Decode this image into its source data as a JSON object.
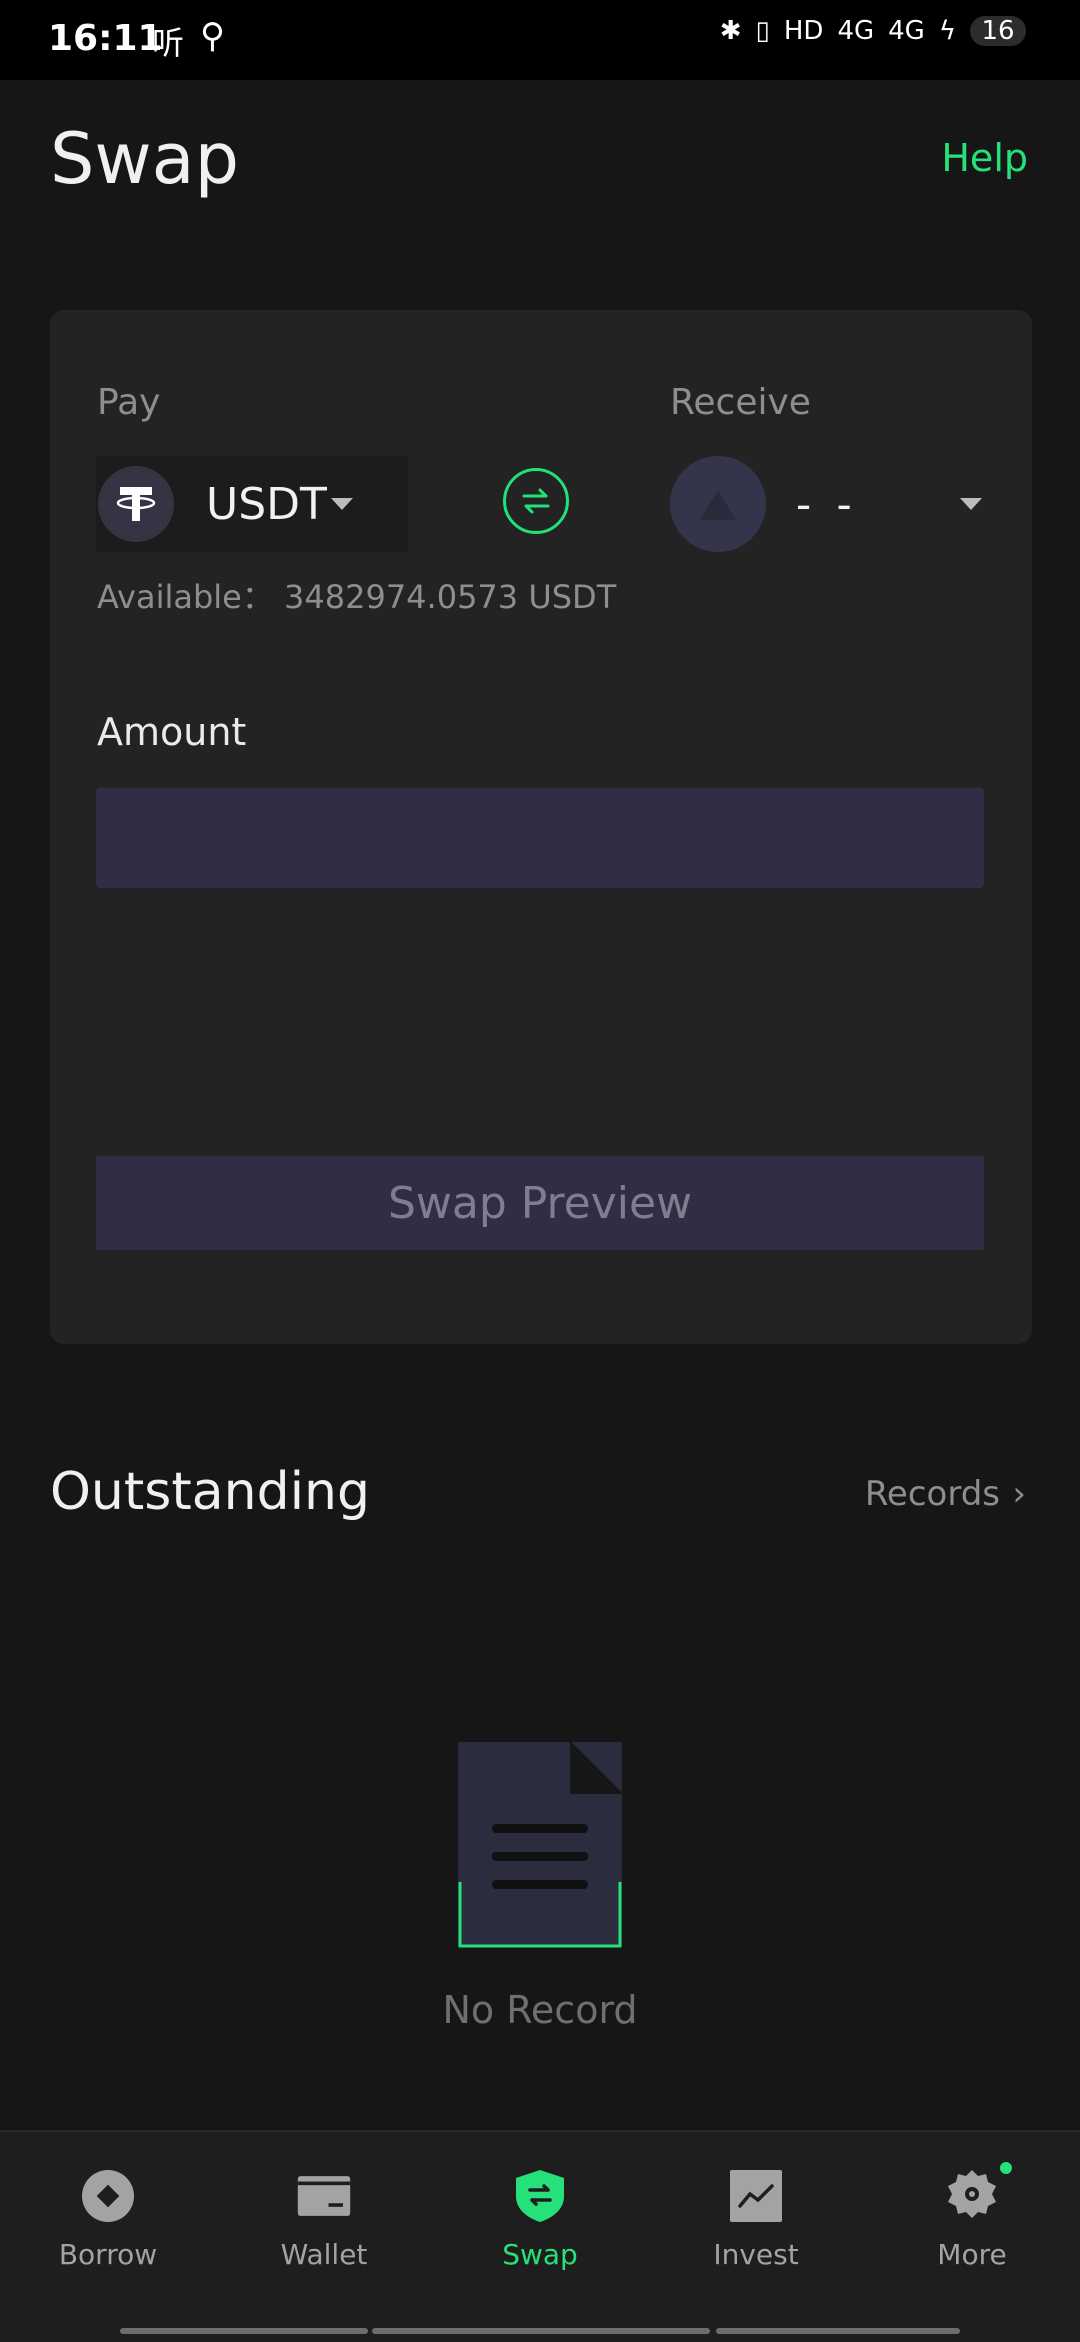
{
  "status_bar": {
    "time": "16:11",
    "cn_label": "听",
    "battery": "16",
    "signal_labels": [
      "HD",
      "4G",
      "4G"
    ]
  },
  "header": {
    "title": "Swap",
    "help": "Help"
  },
  "swap": {
    "pay_label": "Pay",
    "receive_label": "Receive",
    "pay_token": "USDT",
    "receive_token": "- -",
    "available": "Available：  3482974.0573 USDT",
    "amount_label": "Amount",
    "amount_value": "",
    "preview_button": "Swap Preview"
  },
  "outstanding": {
    "title": "Outstanding",
    "records": "Records",
    "chevron": "›",
    "empty_text": "No Record"
  },
  "tabs": [
    {
      "label": "Borrow",
      "icon": "coin-icon"
    },
    {
      "label": "Wallet",
      "icon": "wallet-icon"
    },
    {
      "label": "Swap",
      "icon": "swap-shield-icon"
    },
    {
      "label": "Invest",
      "icon": "chart-icon"
    },
    {
      "label": "More",
      "icon": "gear-icon"
    }
  ],
  "colors": {
    "accent": "#26e07a",
    "background": "#161616",
    "card": "#232323",
    "input": "#302d44"
  }
}
